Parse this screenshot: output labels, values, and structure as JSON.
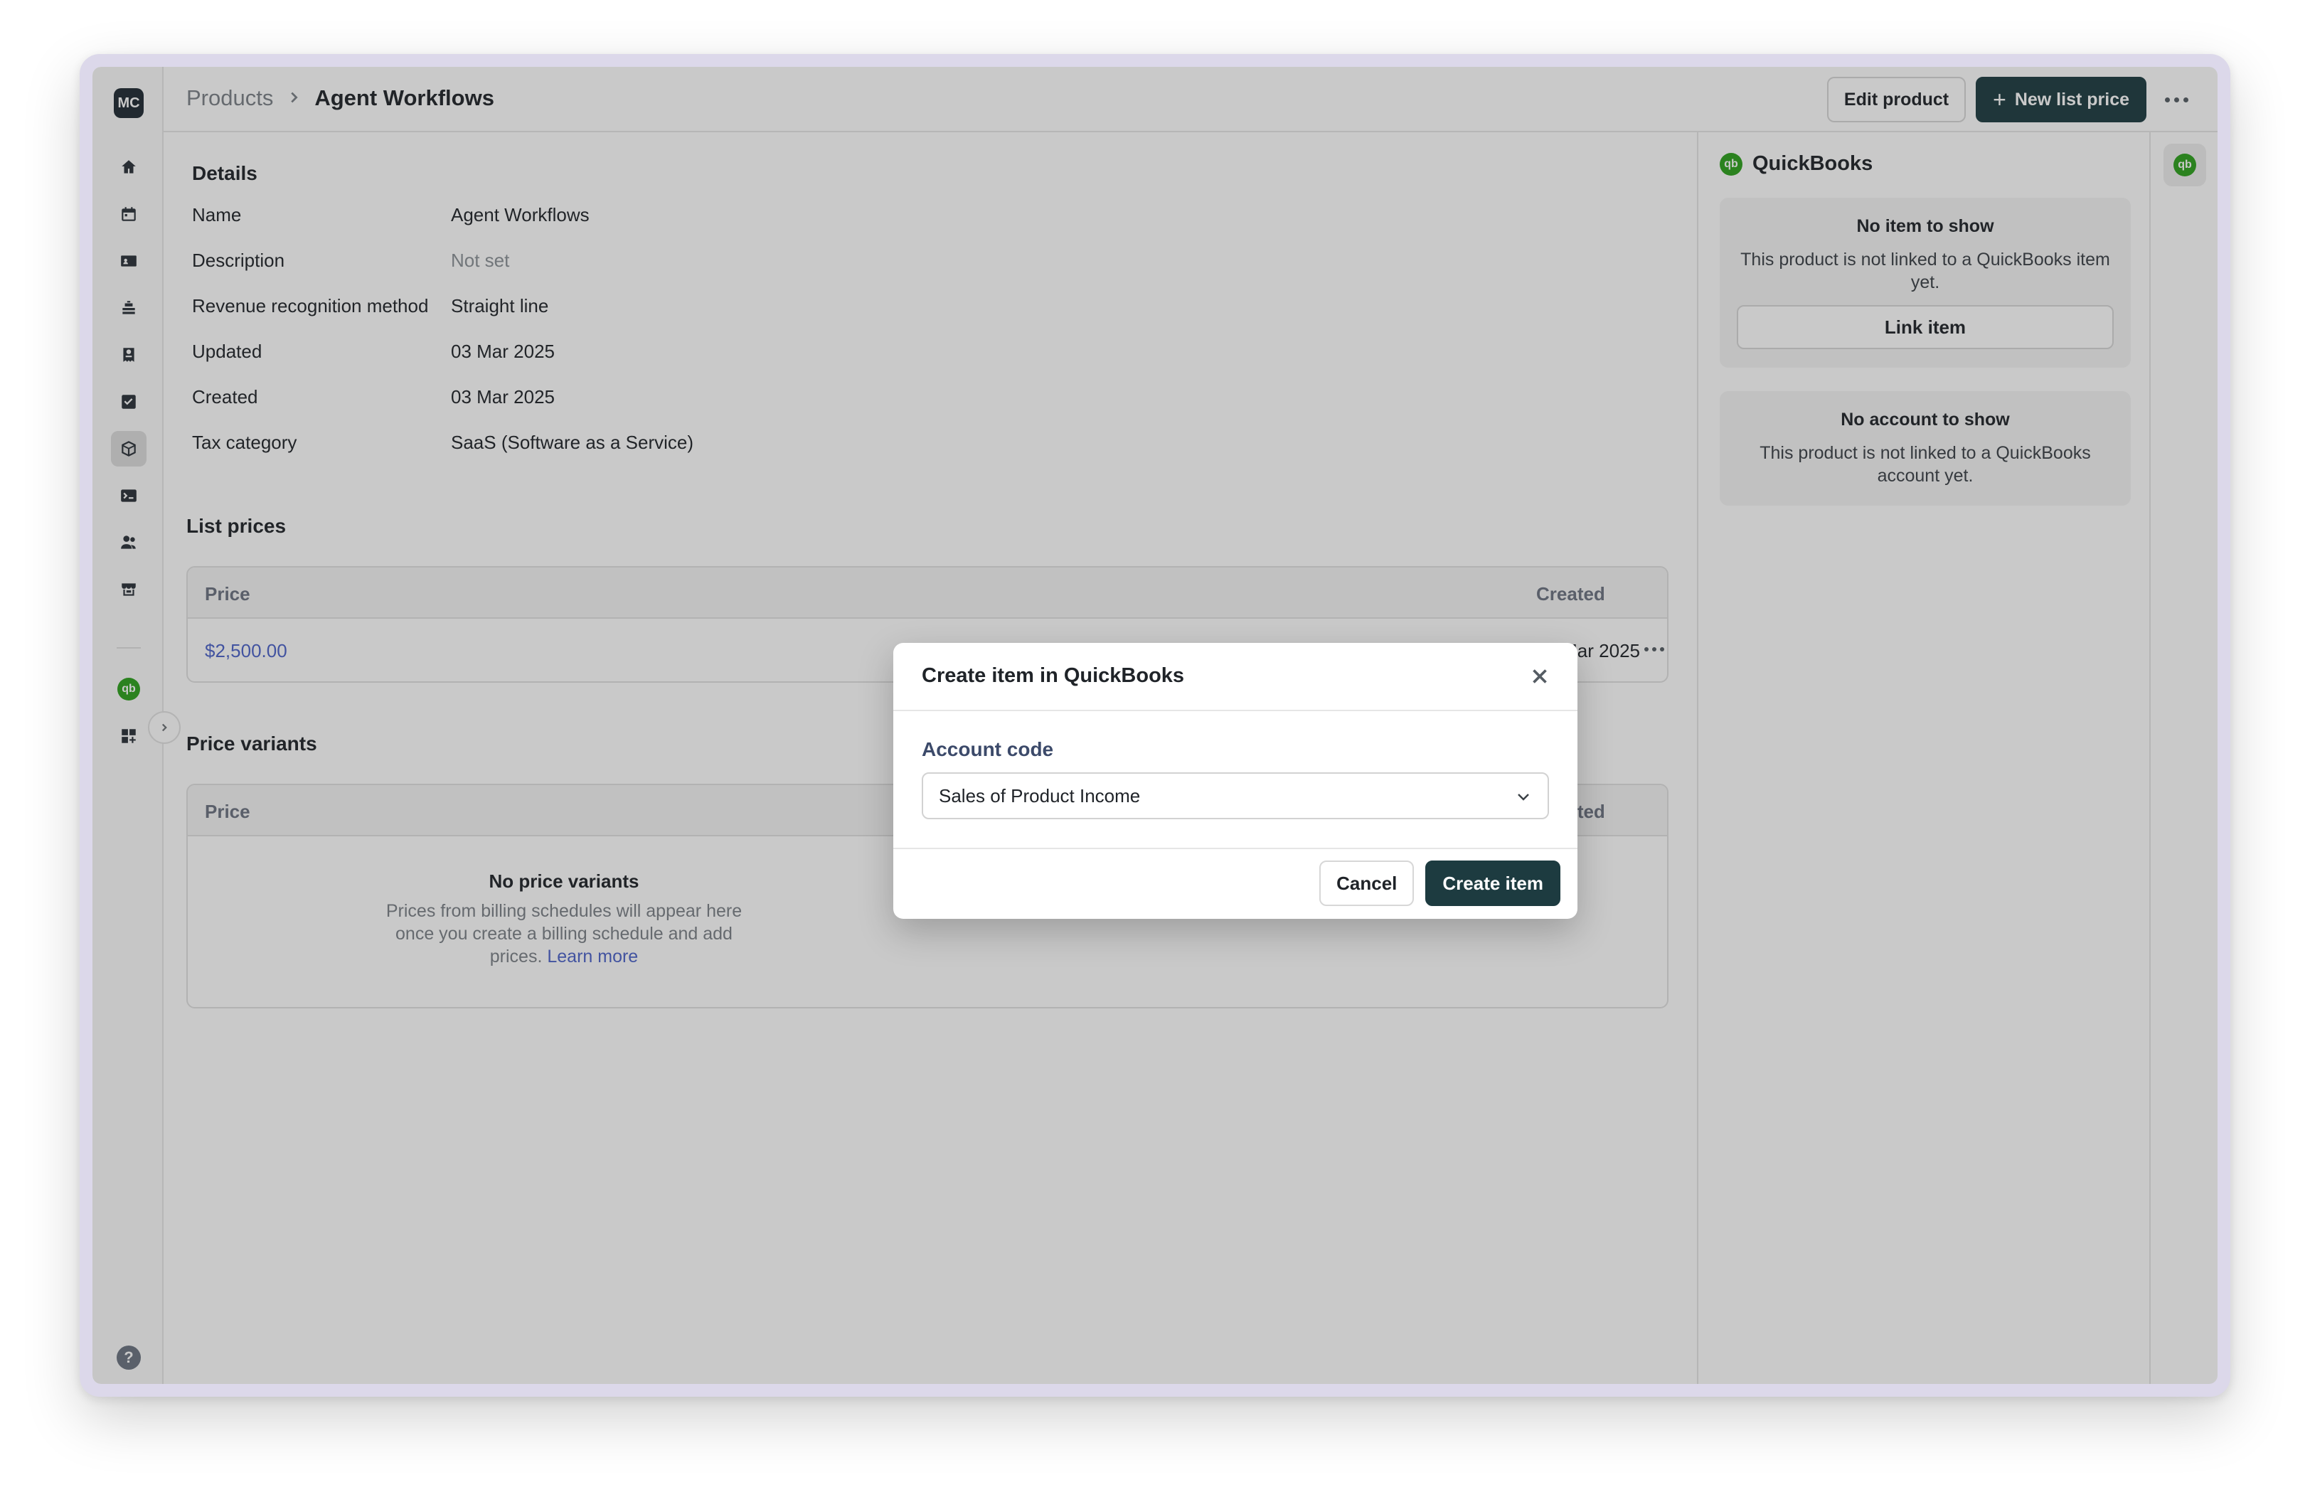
{
  "sidebar": {
    "avatar": "MC",
    "items": [
      {
        "name": "home-icon"
      },
      {
        "name": "calendar-icon"
      },
      {
        "name": "contact-card-icon"
      },
      {
        "name": "stack-icon"
      },
      {
        "name": "receipt-icon"
      },
      {
        "name": "checkbox-icon"
      },
      {
        "name": "box-icon",
        "active": true
      },
      {
        "name": "terminal-icon"
      },
      {
        "name": "users-icon"
      },
      {
        "name": "store-icon"
      },
      {
        "name": "quickbooks-icon"
      },
      {
        "name": "apps-icon"
      }
    ],
    "help": "?"
  },
  "header": {
    "breadcrumb_root": "Products",
    "breadcrumb_current": "Agent Workflows",
    "edit_label": "Edit product",
    "new_price_label": "New list price"
  },
  "details": {
    "title": "Details",
    "rows": [
      {
        "label": "Name",
        "value": "Agent Workflows"
      },
      {
        "label": "Description",
        "value": "Not set"
      },
      {
        "label": "Revenue recognition method",
        "value": "Straight line"
      },
      {
        "label": "Updated",
        "value": "03 Mar 2025"
      },
      {
        "label": "Created",
        "value": "03 Mar 2025"
      },
      {
        "label": "Tax category",
        "value": "SaaS (Software as a Service)"
      }
    ]
  },
  "list_prices": {
    "title": "List prices",
    "columns": {
      "price": "Price",
      "created": "Created"
    },
    "rows": [
      {
        "price": "$2,500.00",
        "created": "03 Mar 2025"
      }
    ]
  },
  "price_variants": {
    "title": "Price variants",
    "columns": {
      "price": "Price",
      "created": "Created"
    },
    "empty_title": "No price variants",
    "empty_text": "Prices from billing schedules will appear here once you create a billing schedule and add prices.",
    "learn_more": "Learn more"
  },
  "quickbooks": {
    "logo": "qb",
    "title": "QuickBooks",
    "item_card": {
      "title": "No item to show",
      "text": "This product is not linked to a QuickBooks item yet.",
      "button": "Link item"
    },
    "account_card": {
      "title": "No account to show",
      "text": "This product is not linked to a QuickBooks account yet."
    }
  },
  "modal": {
    "title": "Create item in QuickBooks",
    "field_label": "Account code",
    "selected_value": "Sales of Product Income",
    "cancel_label": "Cancel",
    "create_label": "Create item"
  }
}
